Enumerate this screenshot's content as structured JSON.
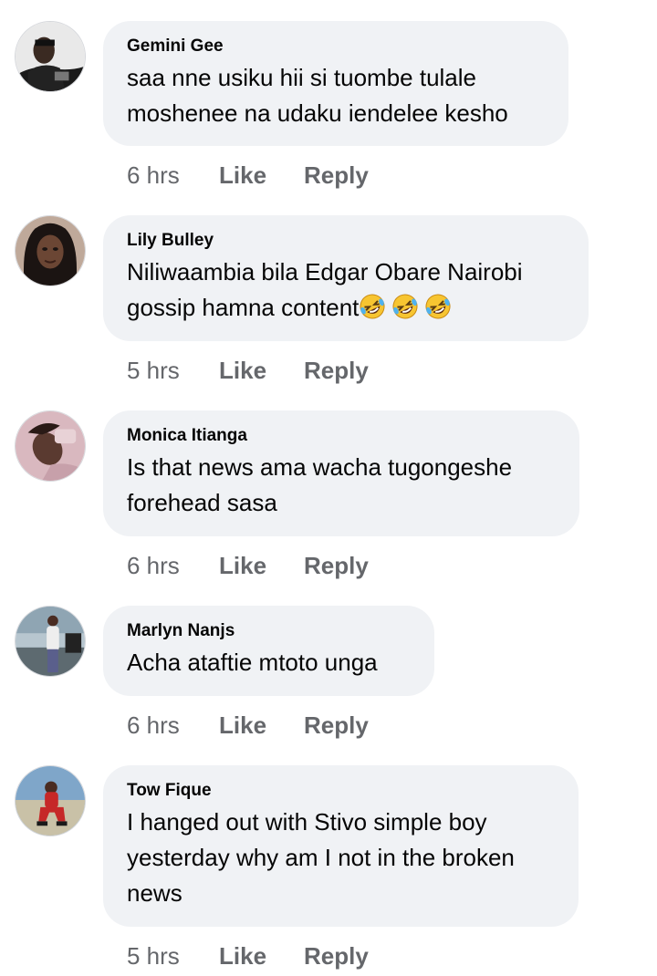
{
  "comments": [
    {
      "author": "Gemini Gee",
      "lines": [
        "saa nne usiku hii si tuombe tulale",
        "moshenee na udaku iendelee kesho"
      ],
      "time": "6 hrs",
      "like_label": "Like",
      "reply_label": "Reply"
    },
    {
      "author": "Lily Bulley",
      "lines": [
        "Niliwaambia bila Edgar Obare Nairobi",
        "gossip hamna content"
      ],
      "emoji": [
        "rolling-on-floor-laughing",
        "rolling-on-floor-laughing",
        "rolling-on-floor-laughing"
      ],
      "time": "5 hrs",
      "like_label": "Like",
      "reply_label": "Reply"
    },
    {
      "author": "Monica Itianga",
      "lines": [
        "Is that news ama wacha tugongeshe",
        "forehead sasa"
      ],
      "time": "6 hrs",
      "like_label": "Like",
      "reply_label": "Reply"
    },
    {
      "author": "Marlyn Nanjs",
      "lines": [
        "Acha ataftie mtoto unga"
      ],
      "time": "6 hrs",
      "like_label": "Like",
      "reply_label": "Reply"
    },
    {
      "author": "Tow Fique",
      "lines": [
        "I hanged out with Stivo simple boy",
        "yesterday why am I not in the broken",
        "news"
      ],
      "time": "5 hrs",
      "like_label": "Like",
      "reply_label": "Reply"
    }
  ],
  "colors": {
    "bubble_bg": "#f0f2f5",
    "text": "#050505",
    "secondary_text": "#65676b"
  }
}
